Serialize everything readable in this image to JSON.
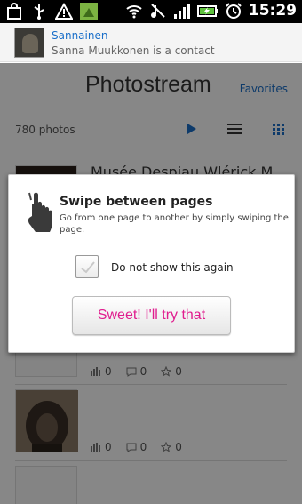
{
  "status_bar": {
    "time": "15:29",
    "icons": [
      "shopping-bag-icon",
      "usb-icon",
      "warning-icon",
      "android-market-icon",
      "wifi-icon",
      "mute-icon",
      "signal-icon",
      "battery-charging-icon",
      "alarm-icon"
    ]
  },
  "header": {
    "name": "Sannainen",
    "subtitle": "Sanna Muukkonen is a contact"
  },
  "page": {
    "title": "Photostream",
    "favorites_link": "Favorites"
  },
  "toolbar": {
    "count": "780 photos"
  },
  "items": [
    {
      "title": "Musée Despiau Wlérick M..."
    },
    {
      "stats": {
        "views": "0",
        "comments": "0",
        "favorites": "0"
      }
    },
    {
      "stats": {
        "views": "0",
        "comments": "0",
        "favorites": "0"
      }
    }
  ],
  "dialog": {
    "title": "Swipe between pages",
    "body": "Go from one page to another by simply swiping the page.",
    "checkbox_label": "Do not show this again",
    "button_label": "Sweet!  I'll try that"
  },
  "colors": {
    "accent": "#1a6fc9",
    "button_text": "#e01c8e"
  }
}
